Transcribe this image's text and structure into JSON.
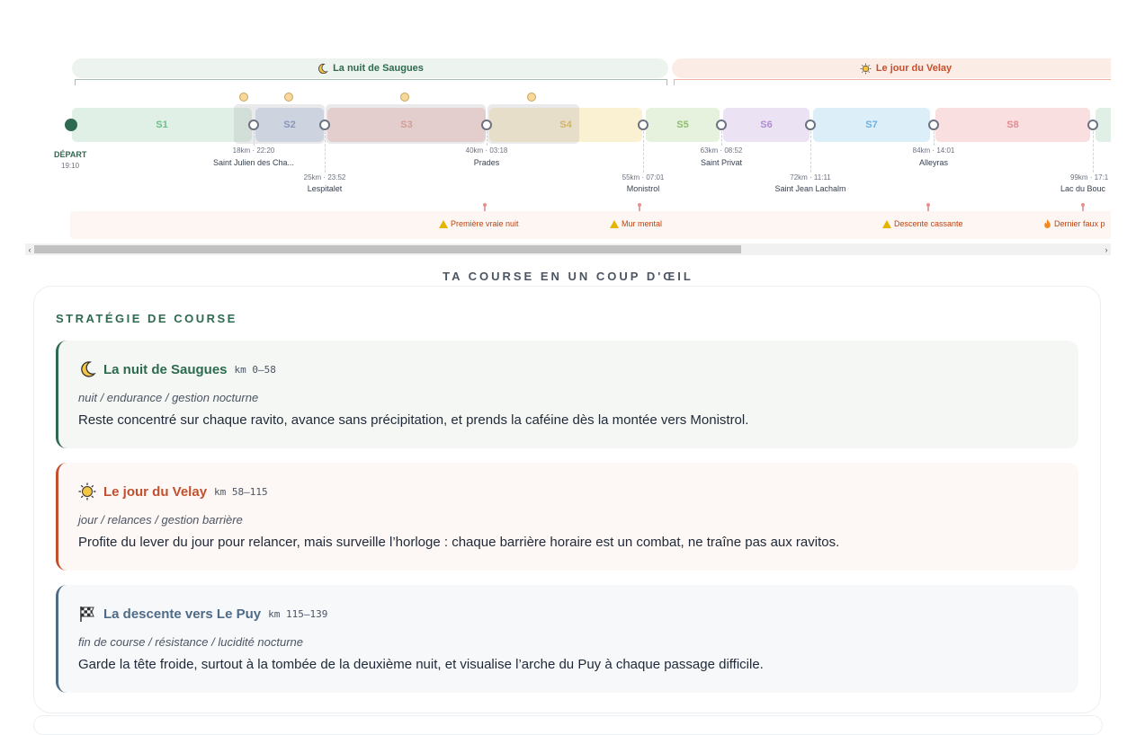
{
  "timeline": {
    "phases": [
      {
        "label": "La nuit de Saugues",
        "icon": "moon-icon"
      },
      {
        "label": "Le jour du Velay",
        "icon": "sun-icon"
      }
    ],
    "start": {
      "label": "DÉPART",
      "time": "19:10"
    },
    "segments": [
      "S1",
      "S2",
      "S3",
      "S4",
      "S5",
      "S6",
      "S7",
      "S8"
    ],
    "checkpoints": [
      {
        "km_time": "18km · 22:20",
        "name": "Saint Julien des Cha..."
      },
      {
        "km_time": "25km · 23:52",
        "name": "Lespitalet"
      },
      {
        "km_time": "40km · 03:18",
        "name": "Prades"
      },
      {
        "km_time": "55km · 07:01",
        "name": "Monistrol"
      },
      {
        "km_time": "63km · 08:52",
        "name": "Saint Privat"
      },
      {
        "km_time": "72km · 11:11",
        "name": "Saint Jean Lachalm"
      },
      {
        "km_time": "84km · 14:01",
        "name": "Alleyras"
      },
      {
        "km_time": "99km · 17:1",
        "name": "Lac du Bouc"
      }
    ],
    "alerts": [
      {
        "label": "Première vraie nuit",
        "icon": "warning-icon"
      },
      {
        "label": "Mur mental",
        "icon": "warning-icon"
      },
      {
        "label": "Descente cassante",
        "icon": "warning-icon"
      },
      {
        "label": "Dernier faux p",
        "icon": "fire-icon"
      }
    ]
  },
  "colors": {
    "night": "#2d6a4f",
    "day": "#c2502e",
    "descent": "#4f6b86"
  },
  "glance": {
    "title": "TA COURSE EN UN COUP D'ŒIL"
  },
  "strategy": {
    "title": "STRATÉGIE DE COURSE",
    "phases": [
      {
        "icon": "moon-icon",
        "name": "La nuit de Saugues",
        "km": "km 0–58",
        "tags": "nuit / endurance / gestion nocturne",
        "desc": "Reste concentré sur chaque ravito, avance sans précipitation, et prends la caféine dès la montée vers Monistrol."
      },
      {
        "icon": "sun-icon",
        "name": "Le jour du Velay",
        "km": "km 58–115",
        "tags": "jour / relances / gestion barrière",
        "desc": "Profite du lever du jour pour relancer, mais surveille l’horloge : chaque barrière horaire est un combat, ne traîne pas aux ravitos."
      },
      {
        "icon": "checkered-flag-icon",
        "name": "La descente vers Le Puy",
        "km": "km 115–139",
        "tags": "fin de course / résistance / lucidité nocturne",
        "desc": "Garde la tête froide, surtout à la tombée de la deuxième nuit, et visualise l’arche du Puy à chaque passage difficile."
      }
    ]
  }
}
